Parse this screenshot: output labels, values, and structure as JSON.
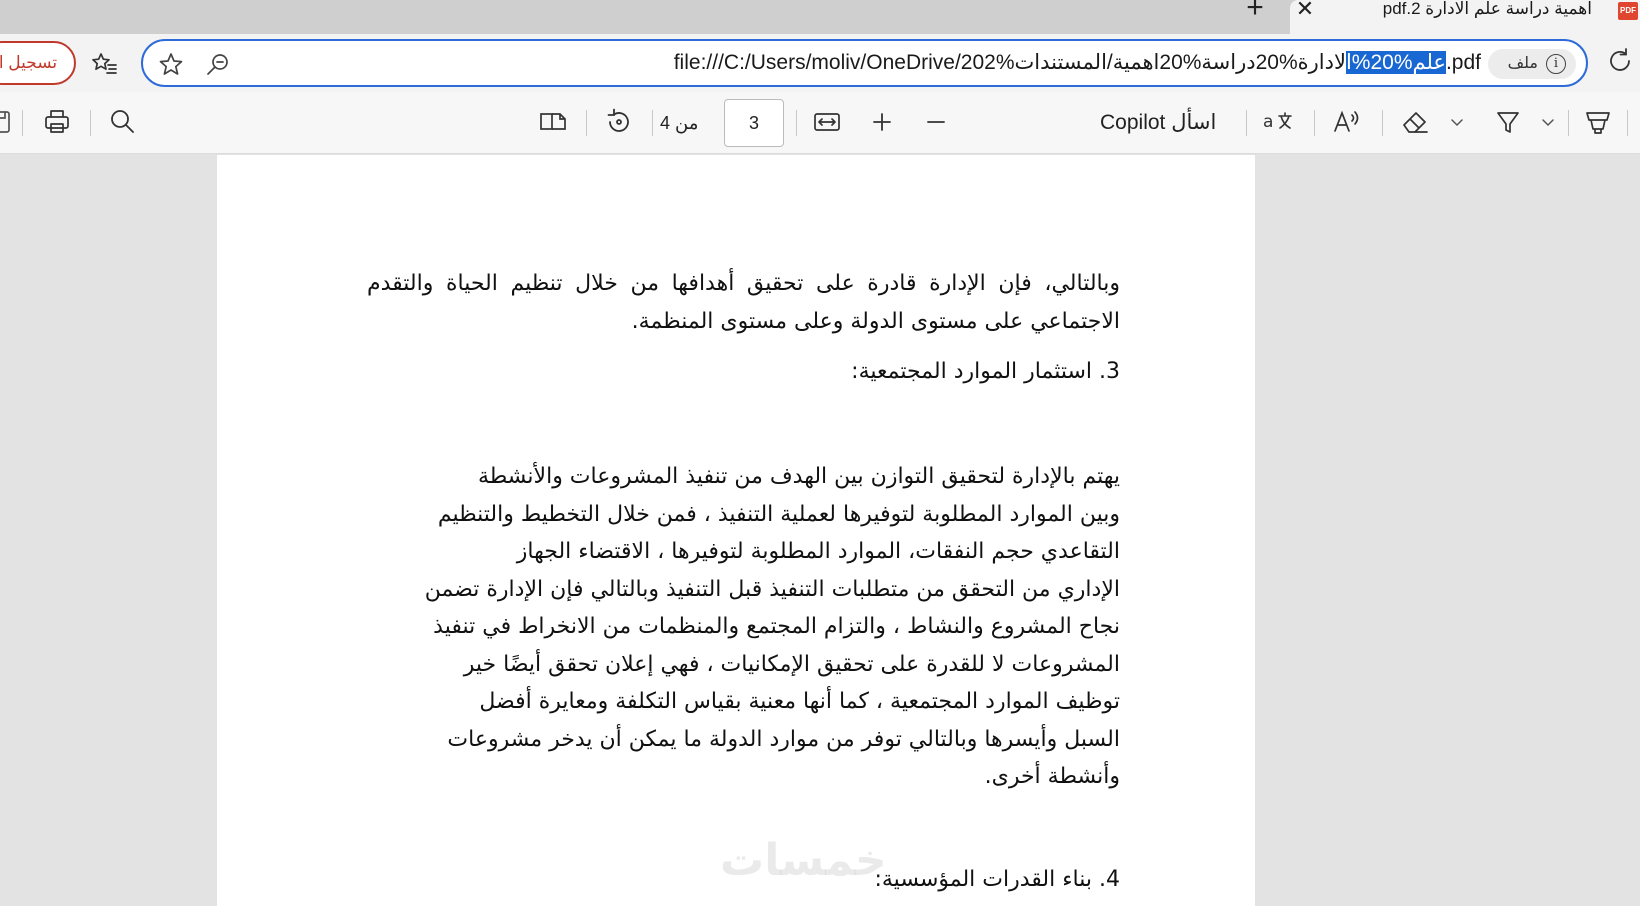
{
  "browser": {
    "tab": {
      "title": "اهمية دراسة علم الادارة pdf.2",
      "favicon_label": "PDF",
      "close_glyph": "✕",
      "new_tab_glyph": "+"
    },
    "signin_label": "تسجيل ا",
    "address": {
      "url_before": "file:///C:/Users/moliv/OneDrive/202%",
      "url_selected": "علم%20%ا",
      "url_after": "لادارة%20دراسة%20اهمية/المستندات.pdf",
      "badge_label": "ملف",
      "info_glyph": "i"
    }
  },
  "pdf_toolbar": {
    "current_page": "3",
    "page_count_label": "من 4",
    "copilot_label": "اسأل Copilot",
    "icons": [
      "save-icon",
      "print-icon",
      "search-icon",
      "page-view-icon",
      "rotate-icon",
      "fit-width-icon",
      "zoom-in-icon",
      "zoom-out-icon",
      "copilot-icon",
      "translate-icon",
      "read-aloud-icon",
      "erase-icon",
      "draw-icon",
      "highlight-icon"
    ]
  },
  "document": {
    "para1": "وبالتالي، فإن الإدارة قادرة على تحقيق أهدافها من خلال تنظيم الحياة والتقدم الاجتماعي على مستوى الدولة وعلى مستوى المنظمة.",
    "heading3": "3. استثمار الموارد المجتمعية:",
    "para2_lines": [
      "يهتم بالإدارة لتحقيق التوازن بين الهدف من تنفيذ المشروعات والأنشطة",
      "وبين الموارد المطلوبة لتوفيرها لعملية التنفيذ ، فمن خلال التخطيط والتنظيم",
      "التقاعدي حجم النفقات، الموارد المطلوبة لتوفيرها ، الاقتضاء الجهاز",
      "الإداري من التحقق من متطلبات التنفيذ قبل التنفيذ وبالتالي فإن الإدارة تضمن",
      "نجاح المشروع والنشاط ، والتزام المجتمع والمنظمات من الانخراط في تنفيذ",
      "المشروعات لا للقدرة على تحقيق الإمكانيات ، فهي إعلان تحقق أيضًا خير",
      "توظيف الموارد المجتمعية ، كما أنها معنية بقياس التكلفة ومعايرة أفضل",
      "السبل وأيسرها وبالتالي توفر من موارد الدولة ما يمكن أن يدخر مشروعات",
      "وأنشطة أخرى."
    ],
    "heading4": "4. بناء القدرات المؤسسية:",
    "watermark": "خمسات"
  }
}
